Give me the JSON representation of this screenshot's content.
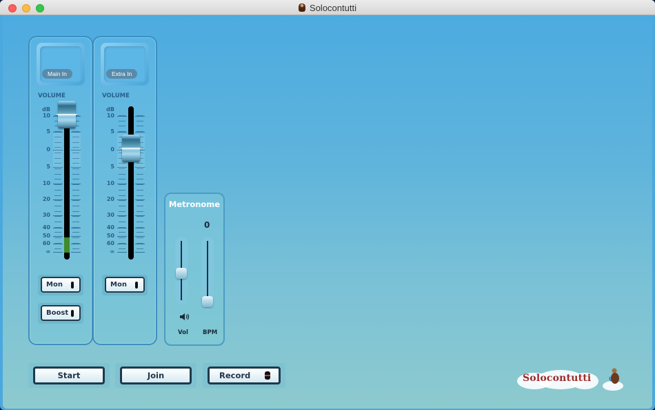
{
  "window": {
    "title": "Solocontutti",
    "controls": [
      "close",
      "minimize",
      "maximize"
    ]
  },
  "channels": [
    {
      "id": "main",
      "input_label": "Main In",
      "volume_label": "VOLUME",
      "scale_unit": "dB",
      "scale_labels": [
        "10",
        "5",
        "0",
        "5",
        "10",
        "20",
        "30",
        "40",
        "50",
        "60",
        "∞"
      ],
      "fader_db": 8,
      "meter_level_db_from": "∞",
      "meter_level_db_to": "50",
      "toggles": [
        {
          "label": "Mon",
          "state": "off"
        },
        {
          "label": "Boost",
          "state": "off"
        }
      ]
    },
    {
      "id": "extra",
      "input_label": "Extra In",
      "volume_label": "VOLUME",
      "scale_unit": "dB",
      "scale_labels": [
        "10",
        "5",
        "0",
        "5",
        "10",
        "20",
        "30",
        "40",
        "50",
        "60",
        "∞"
      ],
      "fader_db": 0,
      "toggles": [
        {
          "label": "Mon",
          "state": "off"
        }
      ]
    }
  ],
  "metronome": {
    "title": "Metronome",
    "bpm_value": "0",
    "vol_label": "Vol",
    "bpm_label": "BPM",
    "vol_level_fraction": 0.45,
    "bpm_level_fraction": 0.0,
    "speaker_icon": "speaker-volume-icon"
  },
  "actions": {
    "start": "Start",
    "join": "Join",
    "record": "Record"
  },
  "branding": {
    "logo_text": "Solocontutti",
    "logo_color": "#9c2b2b",
    "mascot_icon": "cellist-mascot-icon"
  },
  "colors": {
    "background_top": "#4dabe0",
    "background_bottom": "#8dcace",
    "meter_green": "#3e8c2a"
  }
}
